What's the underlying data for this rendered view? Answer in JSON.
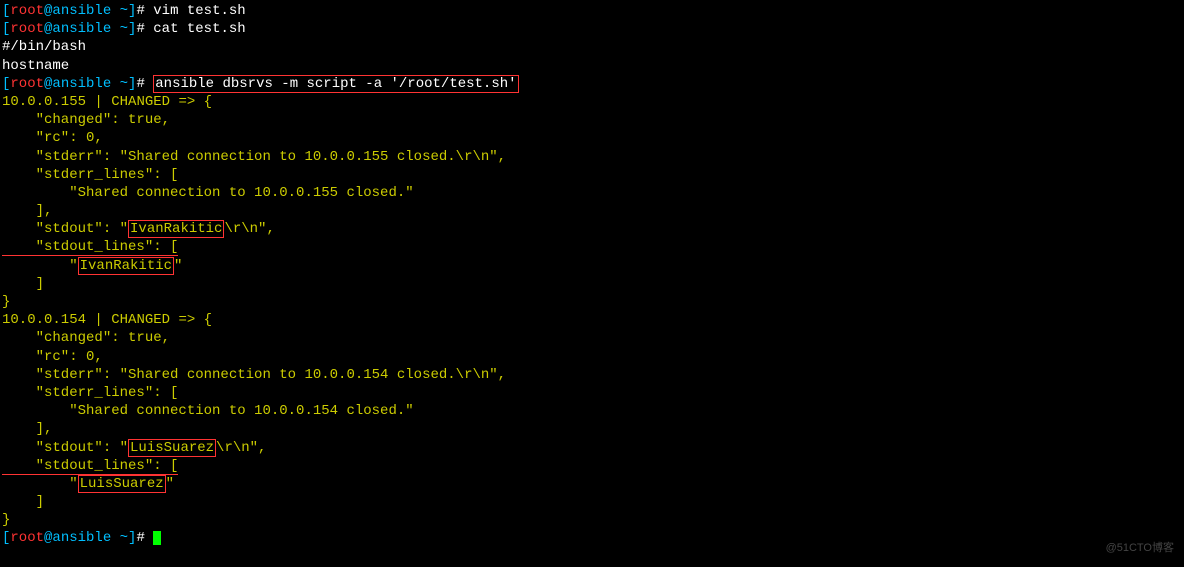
{
  "prompts": {
    "bracket_open": "[",
    "user": "root",
    "at": "@",
    "host": "ansible",
    "space": " ",
    "tilde": "~",
    "bracket_close": "]",
    "hash": "# "
  },
  "lines": {
    "l1_cmd": "vim test.sh",
    "l2_cmd": "cat test.sh",
    "l3": "#/bin/bash",
    "l4": "hostname",
    "l5_cmd": "ansible dbsrvs -m script -a '/root/test.sh'",
    "l6_a": "10.0.0.155",
    "l6_b": " | ",
    "l6_c": "CHANGED",
    "l6_d": " => {",
    "l7": "    \"changed\": true,",
    "l8": "    \"rc\": 0,",
    "l9": "    \"stderr\": \"Shared connection to 10.0.0.155 closed.\\r\\n\",",
    "l10": "    \"stderr_lines\": [",
    "l11": "        \"Shared connection to 10.0.0.155 closed.\"",
    "l12": "    ],",
    "l13_a": "    \"stdout\": \"",
    "l13_box": "IvanRakitic",
    "l13_b": "\\r\\n\",",
    "l14_a": "    \"stdout_lines\": [",
    "l15_a": "        \"",
    "l15_box": "IvanRakitic",
    "l15_b": "\"",
    "l16": "    ]",
    "l17": "}",
    "l18_a": "10.0.0.154",
    "l18_b": " | ",
    "l18_c": "CHANGED",
    "l18_d": " => {",
    "l19": "    \"changed\": true,",
    "l20": "    \"rc\": 0,",
    "l21": "    \"stderr\": \"Shared connection to 10.0.0.154 closed.\\r\\n\",",
    "l22": "    \"stderr_lines\": [",
    "l23": "        \"Shared connection to 10.0.0.154 closed.\"",
    "l24": "    ],",
    "l25_a": "    \"stdout\": \"",
    "l25_box": "LuisSuarez",
    "l25_b": "\\r\\n\",",
    "l26_a": "    \"stdout_lines\": [",
    "l27_a": "        \"",
    "l27_box": "LuisSuarez",
    "l27_b": "\"",
    "l28": "    ]",
    "l29": "}"
  },
  "watermark": "@51CTO博客"
}
